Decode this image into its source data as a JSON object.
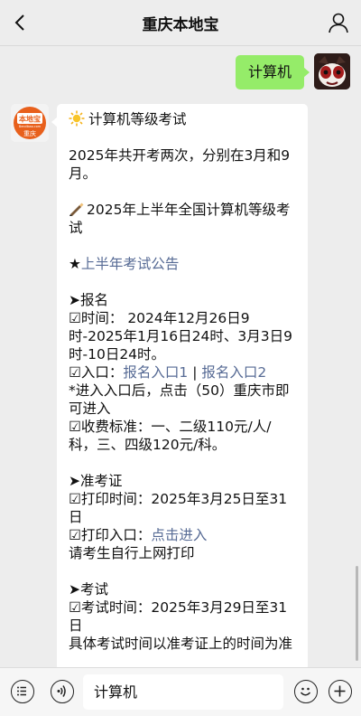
{
  "header": {
    "title": "重庆本地宝"
  },
  "messages": {
    "outgoing_text": "计算机",
    "incoming_lines": [
      "计算机等级考试",
      "",
      "2025年共开考两次，分别在3月和9月。",
      "",
      "2025年上半年全国计算机等级考试",
      "",
      "★",
      "上半年考试公告",
      "",
      "➤报名",
      "☑时间： 2024年12月26日9时-2025年1月16日24时、3月3日9时-10日24时。",
      "☑入口：",
      "报名入口1",
      " | ",
      "报名入口2",
      "*进入入口后，点击（50）重庆市即可进入",
      "☑收费标准：一、二级110元/人/科，三、四级120元/科。",
      "",
      "➤准考证",
      "☑打印时间：2025年3月25日至31日",
      "☑打印入口：",
      "点击进入",
      "请考生自行上网打印",
      "",
      "➤考试",
      "☑考试时间：2025年3月29日至31日",
      "具体考试时间以准考证上的时间为准"
    ]
  },
  "avatar": {
    "logo_text": "本地宝",
    "logo_sub": "重庆",
    "logo_url": "Bendibao.com"
  },
  "input": {
    "value": "计算机"
  },
  "colors": {
    "bubble_out": "#95ec69",
    "link": "#576b95",
    "logo_orange": "#e8601c"
  },
  "icons": [
    "back-chevron-icon",
    "profile-icon",
    "sun-icon",
    "writing-hand-icon",
    "menu-icon",
    "voice-icon",
    "emoji-icon",
    "plus-icon"
  ]
}
